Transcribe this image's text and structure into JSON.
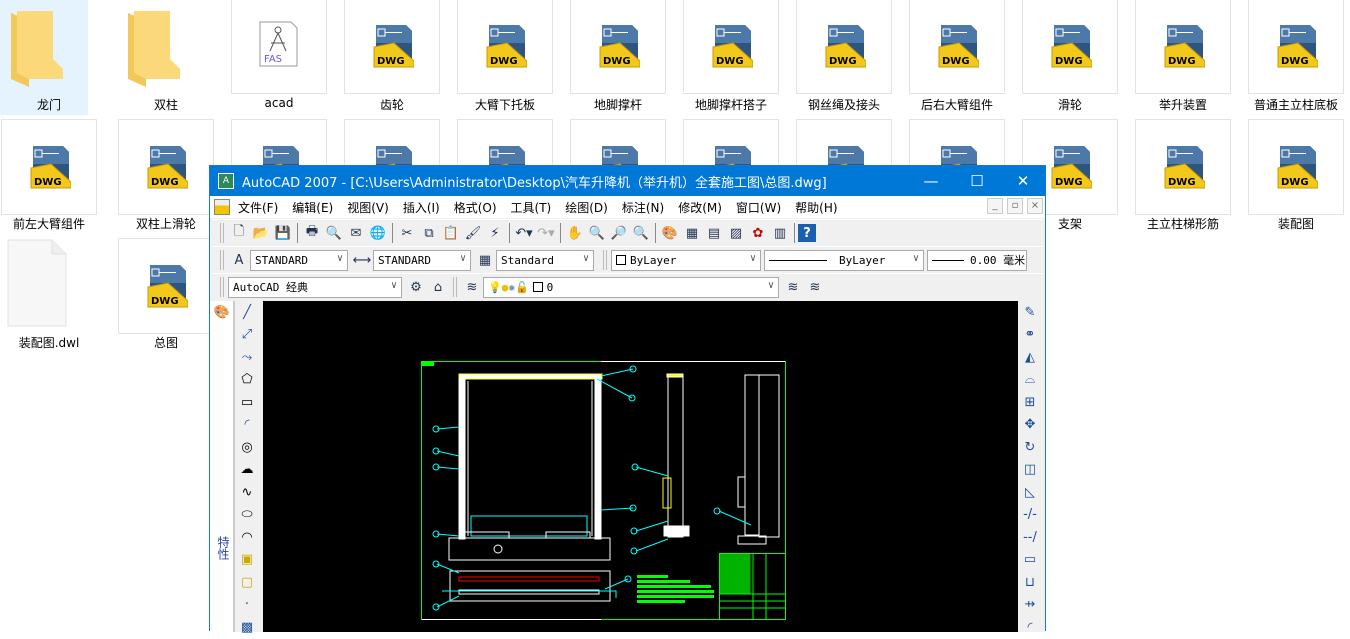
{
  "desktop": {
    "items": [
      {
        "label": "龙门",
        "type": "folder",
        "selected": true
      },
      {
        "label": "双柱",
        "type": "folder"
      },
      {
        "label": "acad",
        "type": "fas",
        "badge": "FAS"
      },
      {
        "label": "齿轮",
        "type": "dwg"
      },
      {
        "label": "大臂下托板",
        "type": "dwg"
      },
      {
        "label": "地脚撑杆",
        "type": "dwg"
      },
      {
        "label": "地脚撑杆搭子",
        "type": "dwg"
      },
      {
        "label": "钢丝绳及接头",
        "type": "dwg"
      },
      {
        "label": "后右大臂组件",
        "type": "dwg"
      },
      {
        "label": "滑轮",
        "type": "dwg"
      },
      {
        "label": "举升装置",
        "type": "dwg"
      },
      {
        "label": "普通主立柱底板",
        "type": "dwg"
      },
      {
        "label": "前左大臂组件",
        "type": "dwg"
      },
      {
        "label": "双柱上滑轮",
        "type": "dwg"
      },
      {
        "label": "支架",
        "type": "dwg"
      },
      {
        "label": "主立柱梯形筋",
        "type": "dwg"
      },
      {
        "label": "装配图",
        "type": "dwg"
      },
      {
        "label": "装配图.dwl",
        "type": "blank"
      },
      {
        "label": "总图",
        "type": "dwg"
      }
    ],
    "dwg_badge": "DWG"
  },
  "window": {
    "title": "AutoCAD 2007 - [C:\\Users\\Administrator\\Desktop\\汽车升降机（举升机）全套施工图\\总图.dwg]",
    "controls": {
      "minimize": "—",
      "maximize": "☐",
      "close": "✕"
    },
    "menu": [
      "文件(F)",
      "编辑(E)",
      "视图(V)",
      "插入(I)",
      "格式(O)",
      "工具(T)",
      "绘图(D)",
      "标注(N)",
      "修改(M)",
      "窗口(W)",
      "帮助(H)"
    ],
    "styles": {
      "text_style": "STANDARD",
      "dim_style": "STANDARD",
      "table_style": "Standard"
    },
    "properties": {
      "color": "ByLayer",
      "linetype": "ByLayer",
      "lineweight": "0.00 毫米"
    },
    "workspace": "AutoCAD 经典",
    "layer": "0",
    "palette_label": "特性",
    "accent": "#0078d7",
    "canvas_bg": "#000000"
  }
}
